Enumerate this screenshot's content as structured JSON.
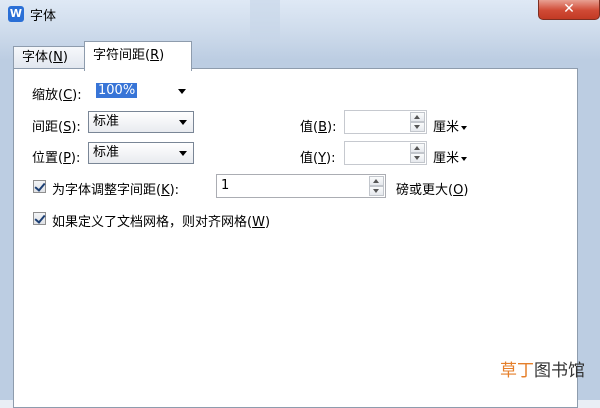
{
  "window": {
    "title": "字体",
    "icon": "wps-writer-icon",
    "close_label": "✕"
  },
  "tabs": [
    {
      "label": "字体(",
      "key": "N",
      "suffix": ")"
    },
    {
      "label": "字符间距(",
      "key": "R",
      "suffix": ")"
    }
  ],
  "scale": {
    "label": "缩放(",
    "key": "C",
    "suffix": "):",
    "value": "100%"
  },
  "spacing": {
    "label": "间距(",
    "key": "S",
    "suffix": "):",
    "value": "标准",
    "by_label": "值(",
    "by_key": "B",
    "by_suffix": "):",
    "by_value": "",
    "unit": "厘米"
  },
  "position": {
    "label": "位置(",
    "key": "P",
    "suffix": "):",
    "value": "标准",
    "by_label": "值(",
    "by_key": "Y",
    "by_suffix": "):",
    "by_value": "",
    "unit": "厘米"
  },
  "kerning": {
    "checked": true,
    "label": "为字体调整字间距(",
    "key": "K",
    "suffix": "):",
    "value": "1",
    "after_label": "磅或更大(",
    "after_key": "O",
    "after_suffix": ")"
  },
  "grid": {
    "checked": true,
    "label": "如果定义了文档网格，则对齐网格(",
    "key": "W",
    "suffix": ")"
  },
  "watermark": {
    "part1": "草丁",
    "part2": "图书馆"
  },
  "colors": {
    "accent": "#3875d7",
    "close": "#d04a35",
    "watermark": "#e57f2b"
  }
}
